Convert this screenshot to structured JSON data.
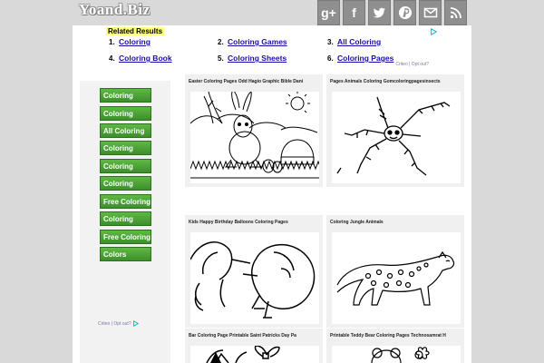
{
  "site": {
    "logo": "Yoand.Biz"
  },
  "social": [
    {
      "icon": "google-plus-icon",
      "glyph": "g+"
    },
    {
      "icon": "facebook-icon",
      "glyph": "f"
    },
    {
      "icon": "twitter-icon",
      "glyph": ""
    },
    {
      "icon": "pinterest-icon",
      "glyph": ""
    },
    {
      "icon": "mail-icon",
      "glyph": ""
    },
    {
      "icon": "rss-icon",
      "glyph": ""
    }
  ],
  "related": {
    "title": "Related Results",
    "items": [
      {
        "num": "1.",
        "label": "Coloring"
      },
      {
        "num": "2.",
        "label": "Coloring Games"
      },
      {
        "num": "3.",
        "label": "All Coloring"
      },
      {
        "num": "4.",
        "label": "Coloring Book"
      },
      {
        "num": "5.",
        "label": "Coloring Sheets"
      },
      {
        "num": "6.",
        "label": "Coloring Pages"
      }
    ],
    "ad_meta": "Criteo  |  Opt out?"
  },
  "sidebar": {
    "buttons": [
      "Coloring",
      "Coloring",
      "All Coloring",
      "Coloring",
      "Coloring",
      "Coloring",
      "Free Coloring",
      "Coloring",
      "Free Coloring",
      "Colors"
    ],
    "ad_meta": "Criteo  |  Opt out?"
  },
  "cards": [
    {
      "title": "Easter Coloring Pages Odd Hagio Graphic Bible Dani"
    },
    {
      "title": "Pages Animals Coloring Gomcoloringpagesinsects"
    },
    {
      "title": "Kids Happy Birthday Balloons Coloring Pages"
    },
    {
      "title": "Coloring Jungle Animals"
    },
    {
      "title": "Bar Coloring Page Printable Saint Patricks Day Pa"
    },
    {
      "title": "Printable Teddy Bear Coloring Pages Technosamrat H"
    }
  ]
}
